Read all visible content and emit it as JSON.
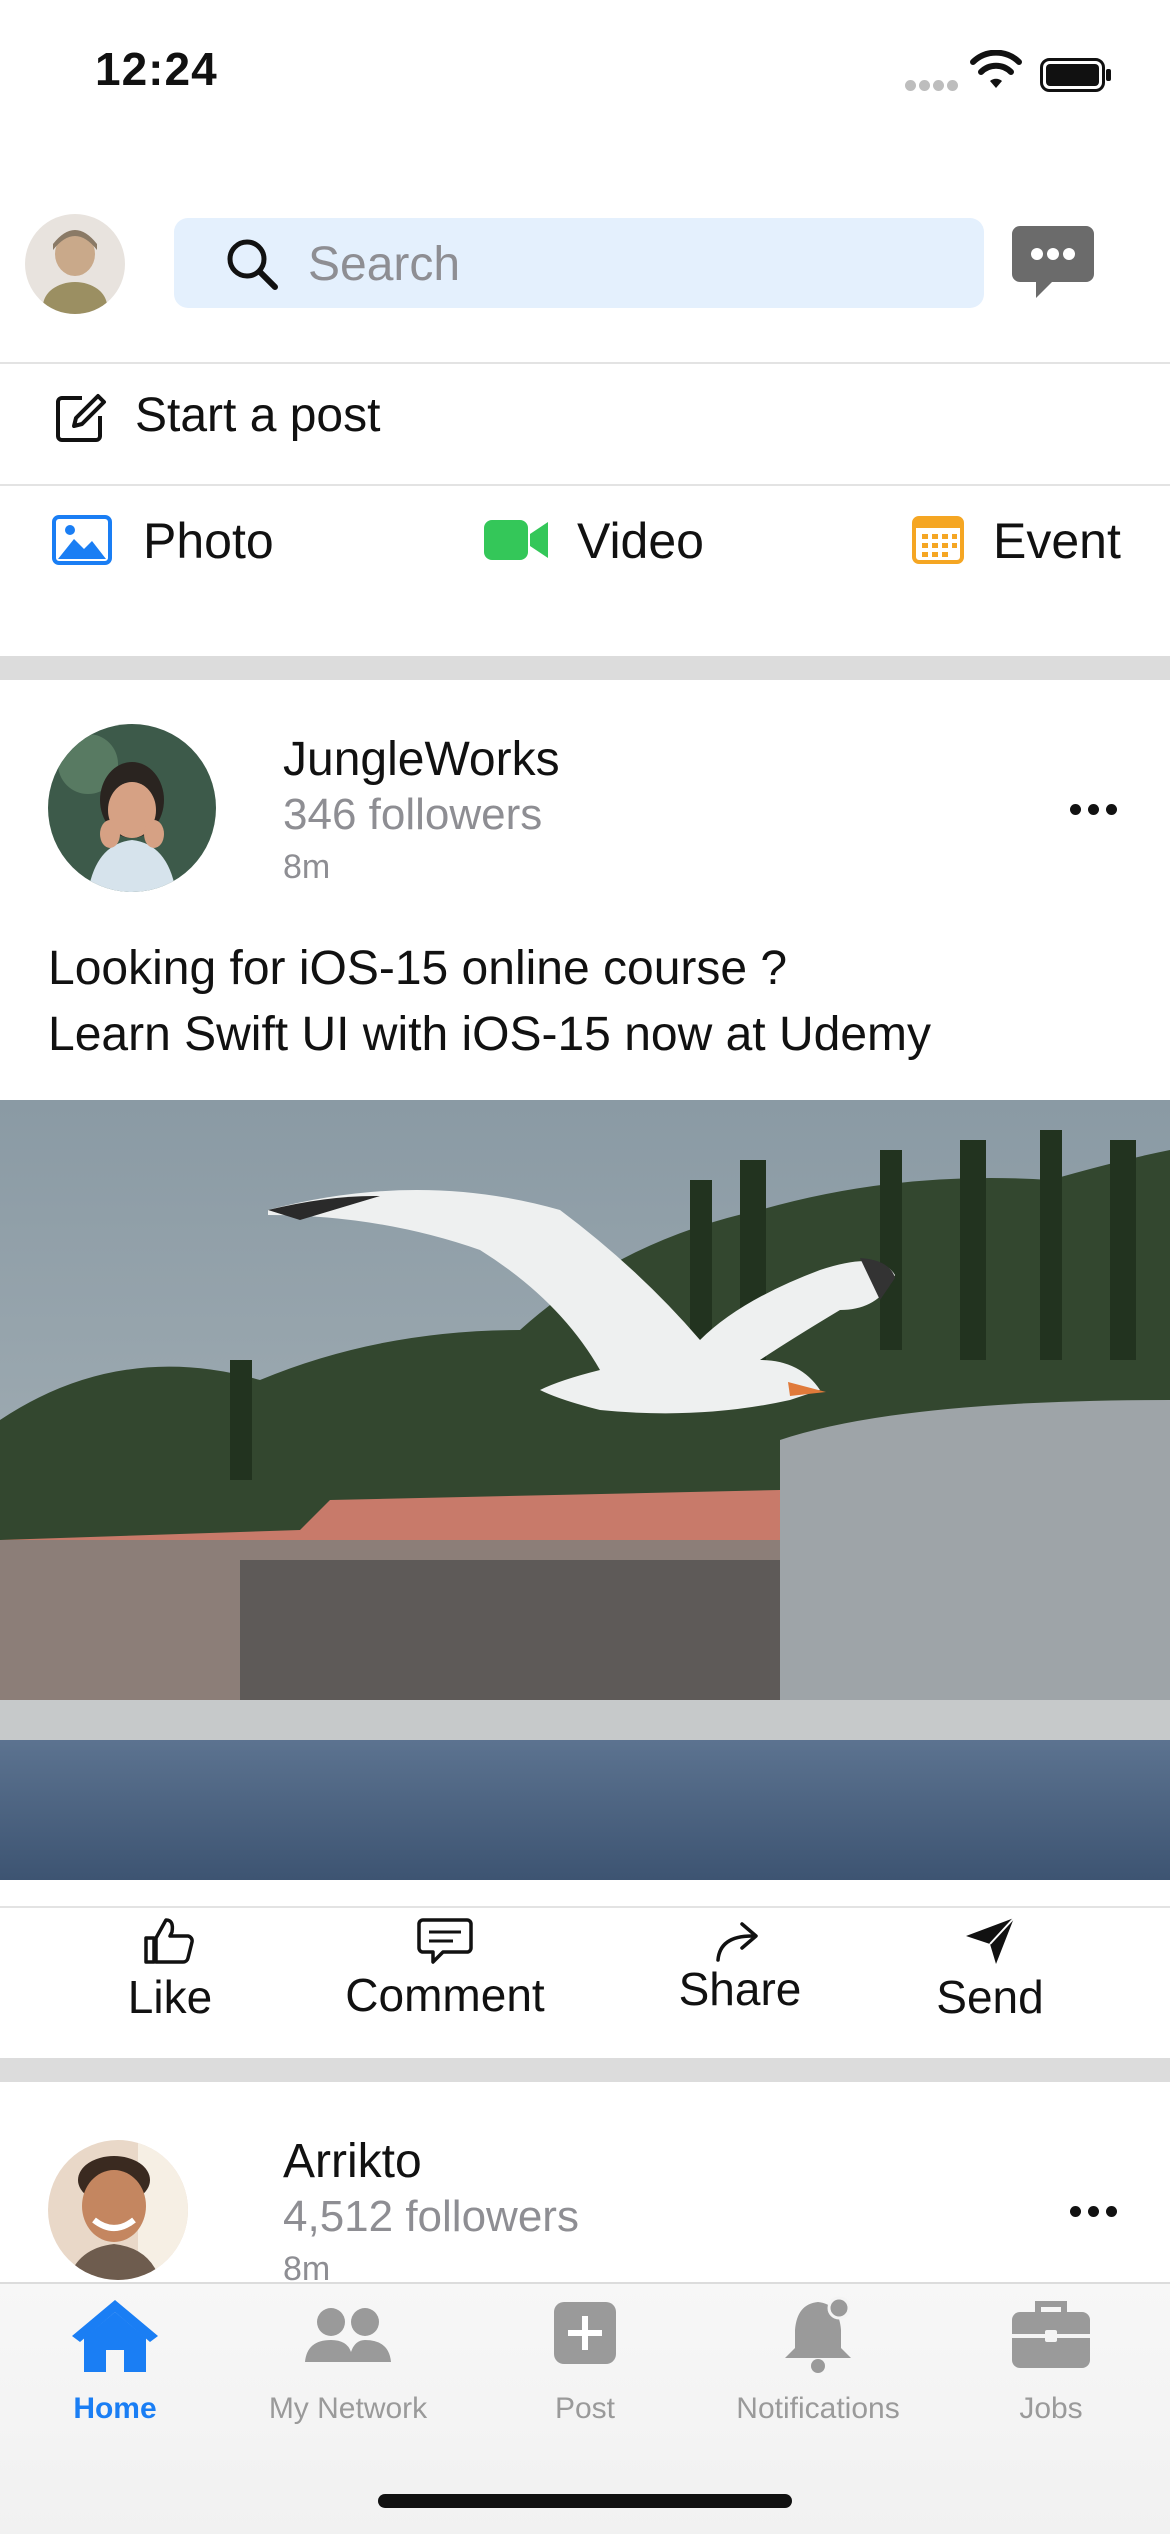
{
  "status_bar": {
    "time": "12:24"
  },
  "header": {
    "search_placeholder": "Search"
  },
  "composer": {
    "start_post": "Start a post",
    "photo": "Photo",
    "video": "Video",
    "event": "Event"
  },
  "posts": [
    {
      "author": "JungleWorks",
      "followers": "346 followers",
      "time": "8m",
      "text_line1": "Looking for iOS-15 online course ?",
      "text_line2": "Learn Swift UI with iOS-15 now at Udemy"
    },
    {
      "author": "Arrikto",
      "followers": "4,512 followers",
      "time": "8m"
    }
  ],
  "actions": {
    "like": "Like",
    "comment": "Comment",
    "share": "Share",
    "send": "Send"
  },
  "tabs": [
    {
      "label": "Home",
      "icon": "home-icon",
      "active": true
    },
    {
      "label": "My Network",
      "icon": "network-icon"
    },
    {
      "label": "Post",
      "icon": "plus-square-icon"
    },
    {
      "label": "Notifications",
      "icon": "bell-icon"
    },
    {
      "label": "Jobs",
      "icon": "briefcase-icon"
    }
  ],
  "colors": {
    "accent": "#1a7ef4",
    "search_bg": "#e4f0fd",
    "video": "#34c759",
    "event": "#f5a623"
  }
}
